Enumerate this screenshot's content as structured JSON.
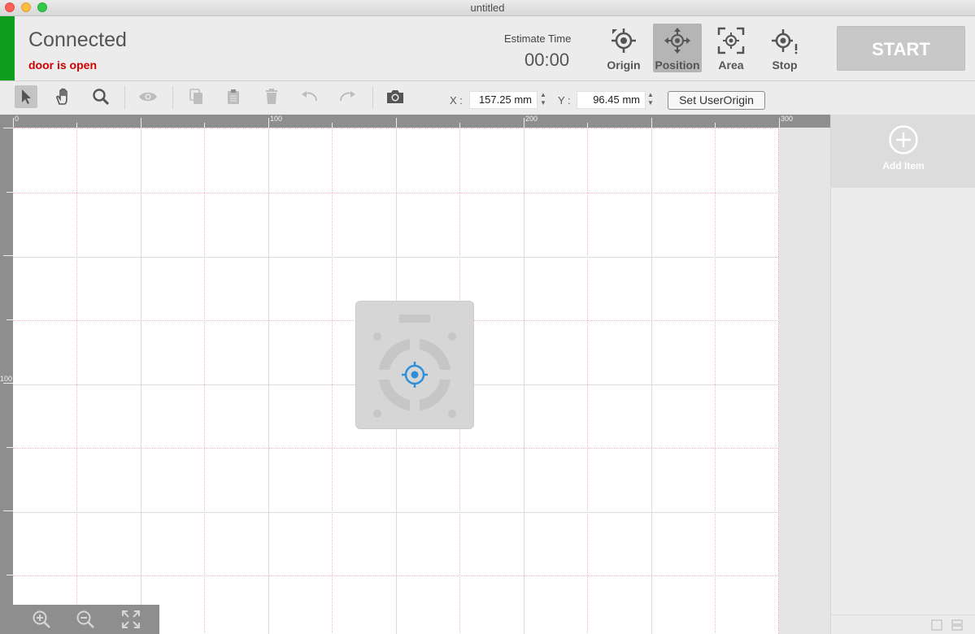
{
  "window": {
    "title": "untitled"
  },
  "header": {
    "connection_status": "Connected",
    "door_status": "door is open",
    "estimate_label": "Estimate Time",
    "estimate_value": "00:00",
    "buttons": [
      {
        "label": "Origin",
        "icon": "origin-icon"
      },
      {
        "label": "Position",
        "icon": "position-icon",
        "active": true
      },
      {
        "label": "Area",
        "icon": "area-icon"
      },
      {
        "label": "Stop",
        "icon": "stop-icon"
      }
    ],
    "start_label": "START",
    "status_color": "#0f9f1e",
    "door_color": "#d10000"
  },
  "toolbar": {
    "tools": [
      "select-arrow",
      "hand",
      "zoom",
      "eye",
      "copy",
      "paste",
      "delete",
      "undo",
      "redo",
      "camera"
    ],
    "x_label": "X :",
    "x_value": "157.25 mm",
    "y_label": "Y :",
    "y_value": "96.45 mm",
    "set_origin_label": "Set UserOrigin"
  },
  "rulers": {
    "top_labels": [
      "0",
      "100",
      "200",
      "300"
    ],
    "left_labels": [
      "100"
    ]
  },
  "canvas": {
    "accent": "#2e8ed6"
  },
  "side_panel": {
    "add_item_label": "Add Item"
  }
}
